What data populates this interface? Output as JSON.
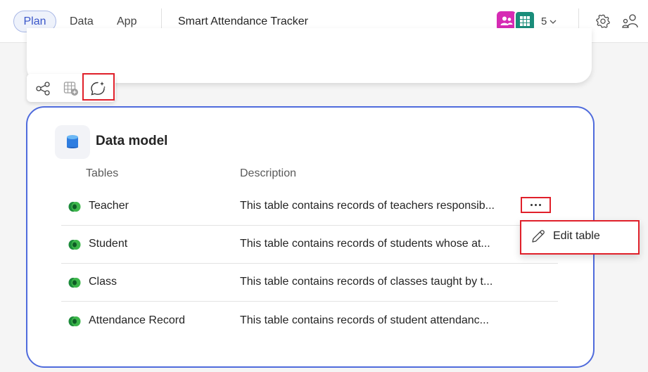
{
  "header": {
    "tabs": [
      {
        "label": "Plan",
        "active": true
      },
      {
        "label": "Data",
        "active": false
      },
      {
        "label": "App",
        "active": false
      }
    ],
    "app_title": "Smart Attendance Tracker",
    "user_count": "5",
    "icons": {
      "settings": "gear-icon",
      "share": "share-people-icon",
      "chevron": "chevron-down-icon"
    }
  },
  "toolbar": {
    "tools": [
      "diagram-icon",
      "table-add-icon",
      "copilot-chat-icon"
    ]
  },
  "data_model": {
    "title": "Data model",
    "columns": {
      "tables": "Tables",
      "description": "Description"
    },
    "rows": [
      {
        "name": "Teacher",
        "description": "This table contains records of teachers responsib..."
      },
      {
        "name": "Student",
        "description": "This table contains records of students whose at..."
      },
      {
        "name": "Class",
        "description": "This table contains records of classes taught by t..."
      },
      {
        "name": "Attendance Record",
        "description": "This table contains records of student attendanc..."
      }
    ]
  },
  "context_menu": {
    "items": [
      {
        "label": "Edit table",
        "icon": "pencil-icon"
      }
    ]
  },
  "colors": {
    "accent": "#4f6bdc",
    "highlight": "#e0202a",
    "dataverse_green": "#1b8a3a"
  }
}
